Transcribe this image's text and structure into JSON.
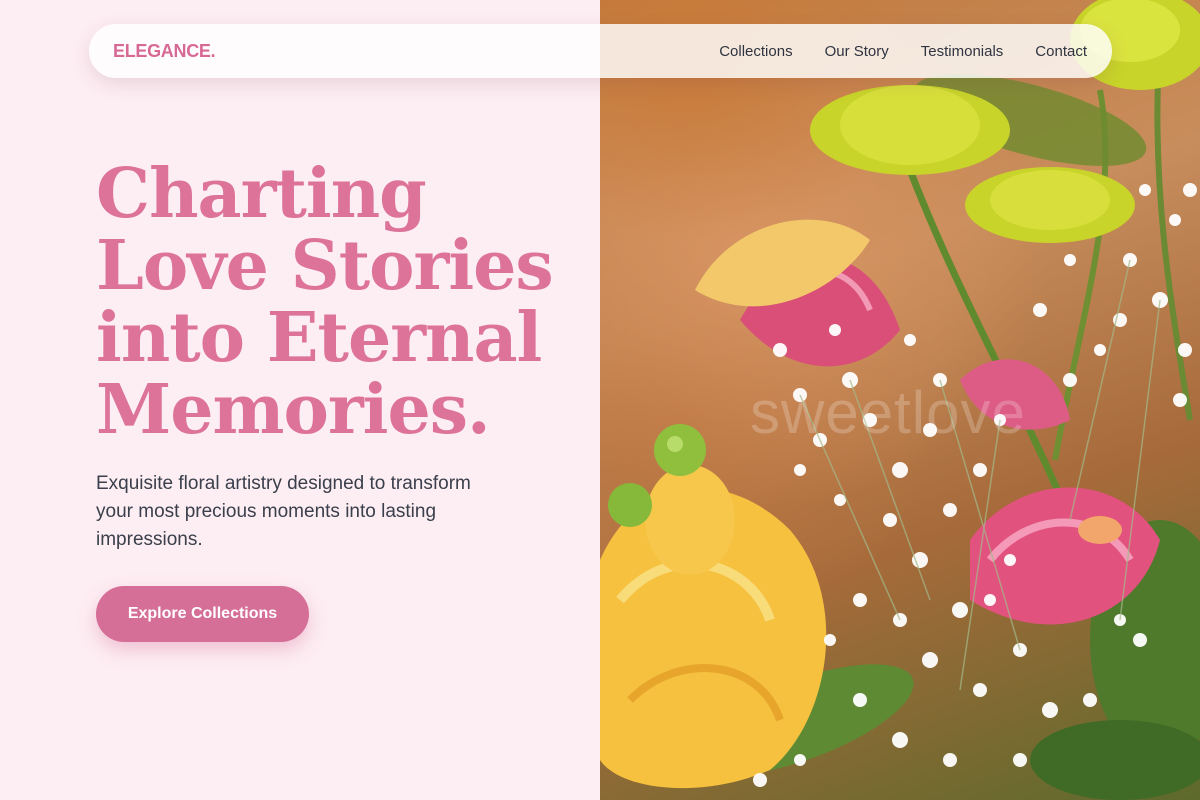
{
  "brand": {
    "name": "ELEGANCE."
  },
  "nav": {
    "items": [
      {
        "label": "Collections"
      },
      {
        "label": "Our Story"
      },
      {
        "label": "Testimonials"
      },
      {
        "label": "Contact"
      }
    ]
  },
  "hero": {
    "title_lines": [
      "Charting",
      "Love Stories",
      "into Eternal",
      "Memories."
    ],
    "subtitle": "Exquisite floral artistry designed to transform your most precious moments into lasting impressions.",
    "cta_label": "Explore Collections"
  },
  "photo": {
    "watermark": "sweetlove"
  },
  "colors": {
    "accent": "#d66f97",
    "title": "#dd7399",
    "background": "#fdeef3",
    "text": "#3a3f4b"
  }
}
